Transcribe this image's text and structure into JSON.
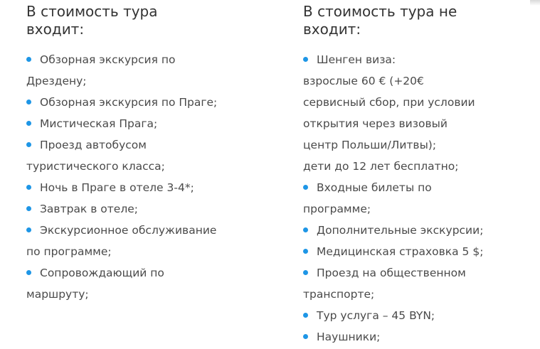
{
  "left": {
    "heading_line1": "В стоимость тура",
    "heading_line2": "входит:",
    "items": [
      {
        "lines": [
          "Обзорная экскурсия по",
          "Дрездену;"
        ]
      },
      {
        "lines": [
          "Обзорная экскурсия по Праге;"
        ]
      },
      {
        "lines": [
          "Мистическая Прага;"
        ]
      },
      {
        "lines": [
          "Проезд автобусом",
          "туристического класса;"
        ]
      },
      {
        "lines": [
          "Ночь в Праге в отеле 3-4*;"
        ]
      },
      {
        "lines": [
          "Завтрак в отеле;"
        ]
      },
      {
        "lines": [
          "Экскурсионное обслуживание",
          "по программе;"
        ]
      },
      {
        "lines": [
          "Сопровождающий по",
          "маршруту;"
        ]
      }
    ]
  },
  "right": {
    "heading_line1": "В стоимость тура не",
    "heading_line2": "входит:",
    "items": [
      {
        "lines": [
          "Шенген виза:",
          "взрослые 60 € (+20€",
          "сервисный сбор, при условии",
          "открытия через визовый",
          "центр Польши/Литвы);",
          "дети до 12 лет бесплатно;"
        ]
      },
      {
        "lines": [
          "Входные билеты по",
          "программе;"
        ]
      },
      {
        "lines": [
          "Дополнительные экскурсии;"
        ]
      },
      {
        "lines": [
          "Медицинская страховка 5 $;"
        ]
      },
      {
        "lines": [
          "Проезд на общественном",
          "транспорте;"
        ]
      },
      {
        "lines": [
          "Тур услуга – 45 BYN;"
        ]
      },
      {
        "lines": [
          "Наушники;"
        ]
      }
    ]
  },
  "colors": {
    "bullet": "#1e96e6",
    "text": "#4a4a4a",
    "heading": "#333333"
  }
}
